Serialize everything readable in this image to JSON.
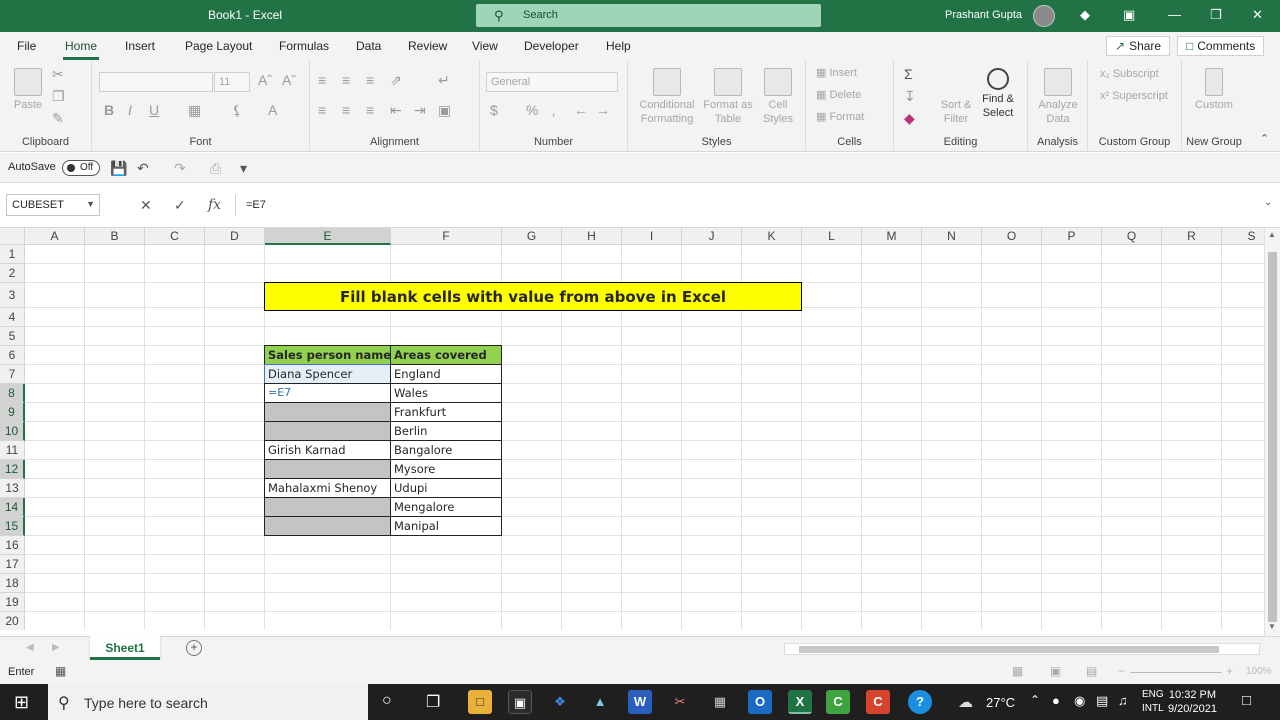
{
  "window": {
    "title": "Book1  -  Excel",
    "search_placeholder": "Search",
    "user": "Prashant Gupta"
  },
  "menu": {
    "tabs": [
      "File",
      "Home",
      "Insert",
      "Page Layout",
      "Formulas",
      "Data",
      "Review",
      "View",
      "Developer",
      "Help"
    ],
    "share": "Share",
    "comments": "Comments"
  },
  "ribbon": {
    "clipboard": {
      "paste": "Paste",
      "label": "Clipboard"
    },
    "font": {
      "size": "11",
      "label": "Font",
      "bold": "B",
      "italic": "I",
      "underline": "U"
    },
    "alignment": {
      "label": "Alignment"
    },
    "number": {
      "format": "General",
      "label": "Number",
      "currency": "$",
      "percent": "%"
    },
    "styles": {
      "conditional": "Conditional Formatting",
      "format_table": "Format as Table",
      "cell_styles": "Cell Styles",
      "label": "Styles"
    },
    "cells": {
      "insert": "Insert",
      "delete": "Delete",
      "format": "Format",
      "label": "Cells"
    },
    "editing": {
      "sort": "Sort & Filter",
      "find": "Find & Select",
      "label": "Editing"
    },
    "analysis": {
      "analyze": "Analyze Data",
      "label": "Analysis"
    },
    "custom_group": {
      "subscript": "Subscript",
      "superscript": "Superscript",
      "label": "Custom Group"
    },
    "new_group": {
      "custom": "Custom",
      "label": "New Group"
    }
  },
  "qat": {
    "autosave": "AutoSave",
    "toggle": "Off"
  },
  "formula_bar": {
    "name_box": "CUBESET",
    "formula": "=E7"
  },
  "columns": [
    "A",
    "B",
    "C",
    "D",
    "E",
    "F",
    "G",
    "H",
    "I",
    "J",
    "K",
    "L",
    "M",
    "N",
    "O",
    "P",
    "Q",
    "R",
    "S"
  ],
  "rows": [
    "1",
    "2",
    "3",
    "4",
    "5",
    "6",
    "7",
    "8",
    "9",
    "10",
    "11",
    "12",
    "13",
    "14",
    "15",
    "16",
    "17",
    "18",
    "19",
    "20"
  ],
  "sheet": {
    "title": "Fill blank cells with value from above in Excel",
    "header": [
      "Sales person name",
      "Areas covered"
    ],
    "data": [
      [
        "Diana Spencer",
        "England"
      ],
      [
        "=E7",
        "Wales"
      ],
      [
        "",
        "Frankfurt"
      ],
      [
        "",
        "Berlin"
      ],
      [
        "Girish Karnad",
        "Bangalore"
      ],
      [
        "",
        "Mysore"
      ],
      [
        "Mahalaxmi Shenoy",
        "Udupi"
      ],
      [
        "",
        "Mengalore"
      ],
      [
        "",
        "Manipal"
      ]
    ]
  },
  "sheet_tabs": [
    "Sheet1"
  ],
  "status": {
    "mode": "Enter",
    "zoom": "100%"
  },
  "taskbar": {
    "search": "Type here to search",
    "temp": "27°C",
    "lang1": "ENG",
    "lang2": "INTL",
    "time": "10:32 PM",
    "date": "9/20/2021"
  }
}
